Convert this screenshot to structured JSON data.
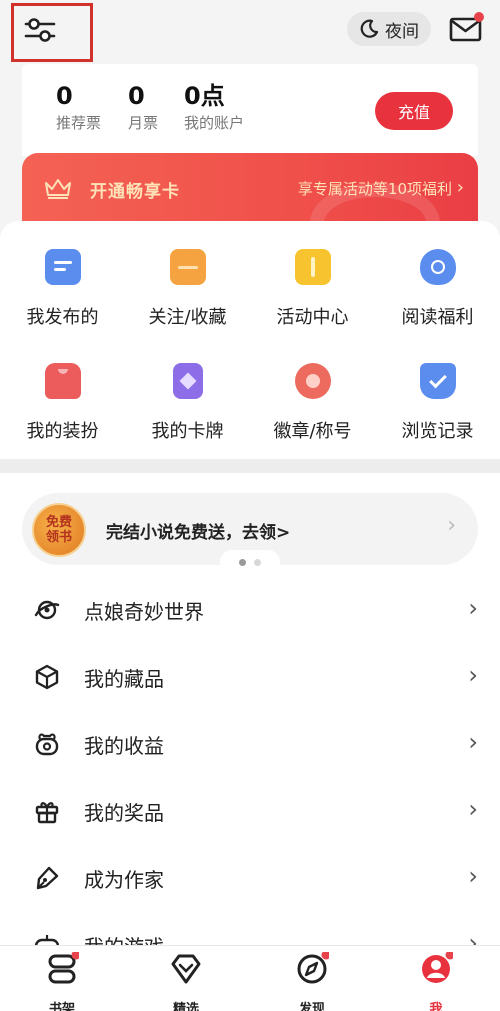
{
  "topbar": {
    "night_mode_label": "夜间"
  },
  "account": {
    "stats": [
      {
        "value": "0",
        "label": "推荐票"
      },
      {
        "value": "0",
        "label": "月票"
      },
      {
        "value": "0点",
        "label": "我的账户"
      }
    ],
    "recharge_label": "充值"
  },
  "vip": {
    "title": "开通畅享卡",
    "link": "享专属活动等10项福利",
    "arrow": "›"
  },
  "grid": {
    "items": [
      {
        "label": "我发布的",
        "icon": "message-icon",
        "color": "#5b8def"
      },
      {
        "label": "关注/收藏",
        "icon": "folder-icon",
        "color": "#f5a340"
      },
      {
        "label": "活动中心",
        "icon": "gift-box-icon",
        "color": "#f7c430"
      },
      {
        "label": "阅读福利",
        "icon": "money-bag-icon",
        "color": "#5b8def"
      },
      {
        "label": "我的装扮",
        "icon": "shirt-icon",
        "color": "#ec5c5c"
      },
      {
        "label": "我的卡牌",
        "icon": "card-icon",
        "color": "#8d6ee8"
      },
      {
        "label": "徽章/称号",
        "icon": "medal-icon",
        "color": "#ec6a5e"
      },
      {
        "label": "浏览记录",
        "icon": "history-icon",
        "color": "#5b8def"
      }
    ]
  },
  "promo": {
    "badge_line1": "免费",
    "badge_line2": "领书",
    "text": "完结小说免费送，去领>",
    "arrow": "›"
  },
  "menu": {
    "items": [
      {
        "label": "点娘奇妙世界",
        "icon": "planet-icon"
      },
      {
        "label": "我的藏品",
        "icon": "cube-icon"
      },
      {
        "label": "我的收益",
        "icon": "wallet-icon"
      },
      {
        "label": "我的奖品",
        "icon": "gift-icon"
      },
      {
        "label": "成为作家",
        "icon": "pen-icon"
      },
      {
        "label": "我的游戏",
        "icon": "gamepad-icon"
      }
    ],
    "arrow": "›"
  },
  "bottom_nav": {
    "items": [
      {
        "label": "书架",
        "icon": "bookshelf-icon"
      },
      {
        "label": "精选",
        "icon": "diamond-icon"
      },
      {
        "label": "发现",
        "icon": "compass-icon"
      },
      {
        "label": "我",
        "icon": "profile-icon"
      }
    ],
    "active": "我"
  },
  "colors": {
    "accent": "#e8333e",
    "banner": "#f0504a",
    "banner_text": "#ffe3b8",
    "notification_dot": "#e8434a"
  }
}
